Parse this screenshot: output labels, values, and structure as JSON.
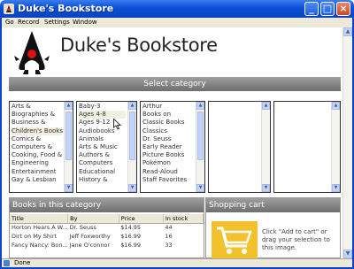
{
  "window": {
    "title": "Duke's Bookstore",
    "controls": {
      "minimize": "_",
      "maximize": "□",
      "close": "×"
    }
  },
  "menu": [
    "Go",
    "Record",
    "Settings",
    "Window"
  ],
  "header": {
    "title": "Duke's Bookstore"
  },
  "select_category": {
    "title": "Select category",
    "lists": [
      [
        "Arts &",
        "Biographies &",
        "Business &",
        "Children's Books",
        "Comics &",
        "Computers &",
        "Cooking, Food &",
        "Engineering",
        "Entertainment",
        "Gay & Lesbian"
      ],
      [
        "Baby-3",
        "Ages 4-8",
        "Ages 9-12",
        "Audiobooks",
        "Animals",
        "Arts & Music",
        "Authors &",
        "Computers",
        "Educational",
        "History &"
      ],
      [
        "Arthur",
        "Books on",
        "Classic Books",
        "Classics",
        "Dr. Seuss",
        "Early Reader",
        "Picture Books",
        "Pokémon",
        "Read-Aloud",
        "Staff Favorites"
      ],
      [],
      []
    ]
  },
  "books": {
    "title": "Books in this category",
    "columns": [
      "Title",
      "By",
      "Price",
      "In stock"
    ],
    "rows": [
      [
        "Horton Hears A W...",
        "Dr. Seuss",
        "$14.95",
        "44"
      ],
      [
        "Dirt on My Shirt",
        "Jeff Foxworthy",
        "$16.99",
        "16"
      ],
      [
        "Fancy Nancy: Bon...",
        "Jane O'connor",
        "$16.99",
        "33"
      ]
    ]
  },
  "cart": {
    "title": "Shopping cart",
    "hint": "Click \"Add to cart\" or drag your selection to this image."
  },
  "status": {
    "text": "Done"
  },
  "colors": {
    "titlebar": "#0a4fd6",
    "section_header": "#8a8a8a",
    "cart_accent": "#f2c12c"
  }
}
